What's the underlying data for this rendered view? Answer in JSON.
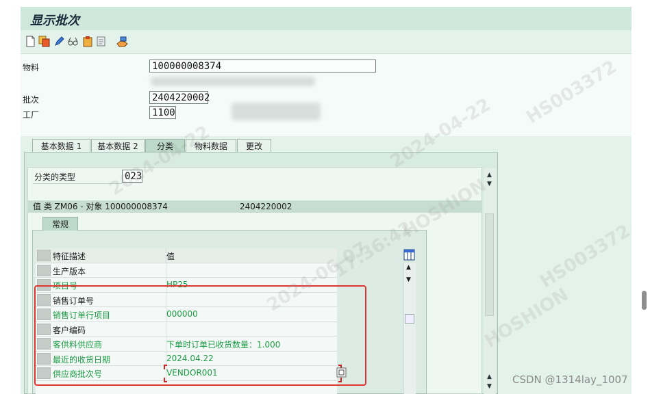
{
  "window": {
    "title": "显示批次"
  },
  "toolbar": {
    "icons": [
      "new-document-icon",
      "copy-icon",
      "edit-pencil-icon",
      "glasses-display-icon",
      "clipboard-icon",
      "print-form-icon",
      "hand-money-icon"
    ]
  },
  "header": {
    "material_label": "物料",
    "material_value": "100000008374",
    "batch_label": "批次",
    "batch_value": "2404220002",
    "plant_label": "工厂",
    "plant_value": "1100"
  },
  "tabs": [
    "基本数据 1",
    "基本数据 2",
    "分类",
    "物料数据",
    "更改"
  ],
  "classification": {
    "class_type_label": "分类的类型",
    "class_type_value": "023",
    "value_bar_prefix": "值 类 ZM06 - 对象 100000008374",
    "value_bar_batch": "2404220002",
    "subtab": "常规"
  },
  "grid": {
    "col_characteristic": "特征描述",
    "col_value": "值",
    "rows": [
      {
        "name": "生产版本",
        "value": "",
        "green": false
      },
      {
        "name": "项目号",
        "value": "HP25",
        "green": true
      },
      {
        "name": "销售订单号",
        "value": "",
        "green": false
      },
      {
        "name": "销售订单行项目",
        "value": "000000",
        "green": true
      },
      {
        "name": "客户编码",
        "value": "",
        "green": false
      },
      {
        "name": "客供料供应商",
        "value": "下单时订单已收货数量：1.000",
        "green": true
      },
      {
        "name": "最近的收货日期",
        "value": "2024.04.22",
        "green": true
      },
      {
        "name": "供应商批次号",
        "value": "VENDOR001",
        "green": true
      }
    ]
  },
  "watermark": {
    "date": "2024-04-22",
    "user": "HS003372",
    "brand": "HOSHION",
    "time": "17:36:42",
    "date2": "2024-06-07"
  },
  "footer": {
    "source_tag": "CSDN @1314lay_1007"
  }
}
